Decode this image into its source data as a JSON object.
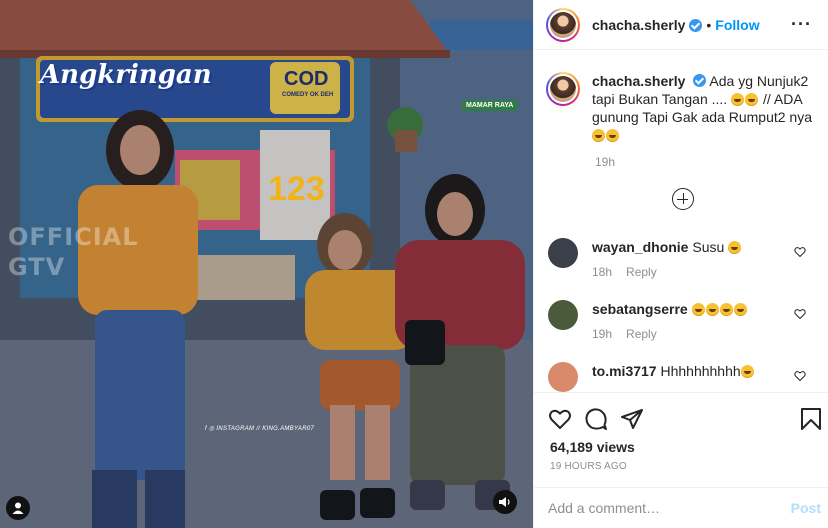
{
  "media": {
    "sign_text": "Angkringan",
    "sign_logo": "COD",
    "sign_logo_sub": "COMEDY OK DEH",
    "set_number": "123",
    "street_sign": "MAMAR RAYA",
    "watermark_line1": "OFFICIAL",
    "watermark_line2": "GTV",
    "credit": "f ◎ INSTAGRAM // KING.AMBYAR07",
    "sound_icon": "speaker-icon",
    "tagged_icon": "user-icon"
  },
  "header": {
    "username": "chacha.sherly",
    "separator": "•",
    "follow_label": "Follow",
    "more_label": "···"
  },
  "caption": {
    "username": "chacha.sherly",
    "text_1": "Ada yg Nunjuk2 tapi Bukan Tangan ....",
    "text_2": "// ADA gunung Tapi Gak ada Rumput2 nya",
    "time": "19h"
  },
  "comments": [
    {
      "username": "wayan_dhonie",
      "text": "Susu",
      "emoji_count": 1,
      "time": "18h",
      "reply": "Reply",
      "avatar_color": "#3a3f4a"
    },
    {
      "username": "sebatangserre",
      "text": "",
      "emoji_count": 4,
      "time": "19h",
      "reply": "Reply",
      "avatar_color": "#4a5a3a"
    },
    {
      "username": "to.mi3717",
      "text": "Hhhhhhhhhh",
      "emoji_count": 1,
      "time": "",
      "reply": "",
      "avatar_color": "#d98a6a"
    }
  ],
  "actions": {
    "views": "64,189 views",
    "ago": "19 HOURS AGO",
    "comment_placeholder": "Add a comment…",
    "post_label": "Post"
  },
  "colors": {
    "link": "#0095f6",
    "verified": "#3897f0",
    "muted": "#8e8e8e"
  }
}
